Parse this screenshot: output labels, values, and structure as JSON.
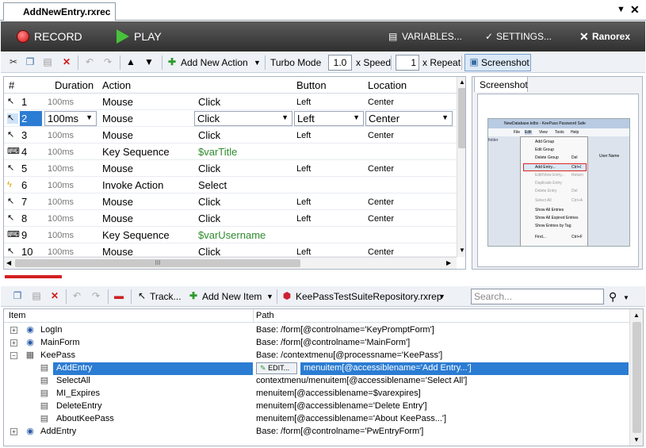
{
  "tab": {
    "title": "AddNewEntry.rxrec"
  },
  "recbar": {
    "record": "RECORD",
    "play": "PLAY",
    "variables": "VARIABLES...",
    "settings": "SETTINGS...",
    "logo": "Ranorex"
  },
  "toolbar1": {
    "add_action": "Add New Action",
    "turbo": "Turbo Mode",
    "speed_value": "1.0",
    "speed_label": "x Speed",
    "repeat_value": "1",
    "repeat_label": "x Repeat",
    "screenshot": "Screenshot"
  },
  "grid": {
    "columns": [
      "#",
      "Duration",
      "Action",
      "",
      "Button",
      "Location"
    ],
    "rows": [
      {
        "num": "1",
        "icon": "mouse-icon",
        "duration": "100ms",
        "action": "Mouse",
        "arg": "Click",
        "button": "Left",
        "location": "Center"
      },
      {
        "num": "2",
        "icon": "mouse-icon",
        "duration": "100ms",
        "action": "Mouse",
        "arg": "Click",
        "button": "Left",
        "location": "Center"
      },
      {
        "num": "3",
        "icon": "mouse-icon",
        "duration": "100ms",
        "action": "Mouse",
        "arg": "Click",
        "button": "Left",
        "location": "Center"
      },
      {
        "num": "4",
        "icon": "keyboard-icon",
        "duration": "100ms",
        "action": "Key Sequence",
        "arg": "$varTitle",
        "button": "",
        "location": ""
      },
      {
        "num": "5",
        "icon": "mouse-icon",
        "duration": "100ms",
        "action": "Mouse",
        "arg": "Click",
        "button": "Left",
        "location": "Center"
      },
      {
        "num": "6",
        "icon": "invoke-icon",
        "duration": "100ms",
        "action": "Invoke Action",
        "arg": "Select",
        "button": "",
        "location": ""
      },
      {
        "num": "7",
        "icon": "mouse-icon",
        "duration": "100ms",
        "action": "Mouse",
        "arg": "Click",
        "button": "Left",
        "location": "Center"
      },
      {
        "num": "8",
        "icon": "mouse-icon",
        "duration": "100ms",
        "action": "Mouse",
        "arg": "Click",
        "button": "Left",
        "location": "Center"
      },
      {
        "num": "9",
        "icon": "keyboard-icon",
        "duration": "100ms",
        "action": "Key Sequence",
        "arg": "$varUsername",
        "button": "",
        "location": ""
      },
      {
        "num": "10",
        "icon": "mouse-icon",
        "duration": "100ms",
        "action": "Mouse",
        "arg": "Click",
        "button": "Left",
        "location": "Center"
      }
    ],
    "hscroll_grip": "III"
  },
  "screenshot_panel": {
    "tab": "Screenshot",
    "window_title": "NewDatabase.kdbx - KeePass Password Safe",
    "menus": [
      "File",
      "Edit",
      "View",
      "Tools",
      "Help"
    ],
    "items": [
      "Add Group",
      "Edit Group",
      "Delete Group",
      "Add Entry...",
      "Edit/View Entry...",
      "Duplicate Entry",
      "Delete Entry",
      "Select All",
      "Show All Entries",
      "Show All Expired Entries",
      "Show Entries by Tag",
      "Find..."
    ],
    "shortcuts": {
      "del": "Del",
      "add": "Ctrl+I",
      "ret": "Return",
      "selall": "Ctrl+A",
      "find": "Ctrl+F"
    },
    "side_label": "folder",
    "user_name": "User Name"
  },
  "toolbar2": {
    "track": "Track...",
    "add_item": "Add New Item",
    "repo": "KeePassTestSuiteRepository.rxrep",
    "search_placeholder": "Search..."
  },
  "repo": {
    "columns": [
      "Item",
      "Path"
    ],
    "edit": "EDIT...",
    "rows": [
      {
        "name": "LogIn",
        "path": "Base: /form[@controlname='KeyPromptForm']"
      },
      {
        "name": "MainForm",
        "path": "Base: /form[@controlname='MainForm']"
      },
      {
        "name": "KeePass",
        "path": "Base: /contextmenu[@processname='KeePass']"
      },
      {
        "name": "AddEntry",
        "path": "menuitem[@accessiblename='Add Entry...']"
      },
      {
        "name": "SelectAll",
        "path": "contextmenu/menuitem[@accessiblename='Select All']"
      },
      {
        "name": "MI_Expires",
        "path": "menuitem[@accessiblename=$varexpires]"
      },
      {
        "name": "DeleteEntry",
        "path": "menuitem[@accessiblename='Delete Entry']"
      },
      {
        "name": "AboutKeePass",
        "path": "menuitem[@accessiblename='About KeePass...']"
      },
      {
        "name": "AddEntry",
        "path": "Base: /form[@controlname='PwEntryForm']"
      }
    ]
  }
}
